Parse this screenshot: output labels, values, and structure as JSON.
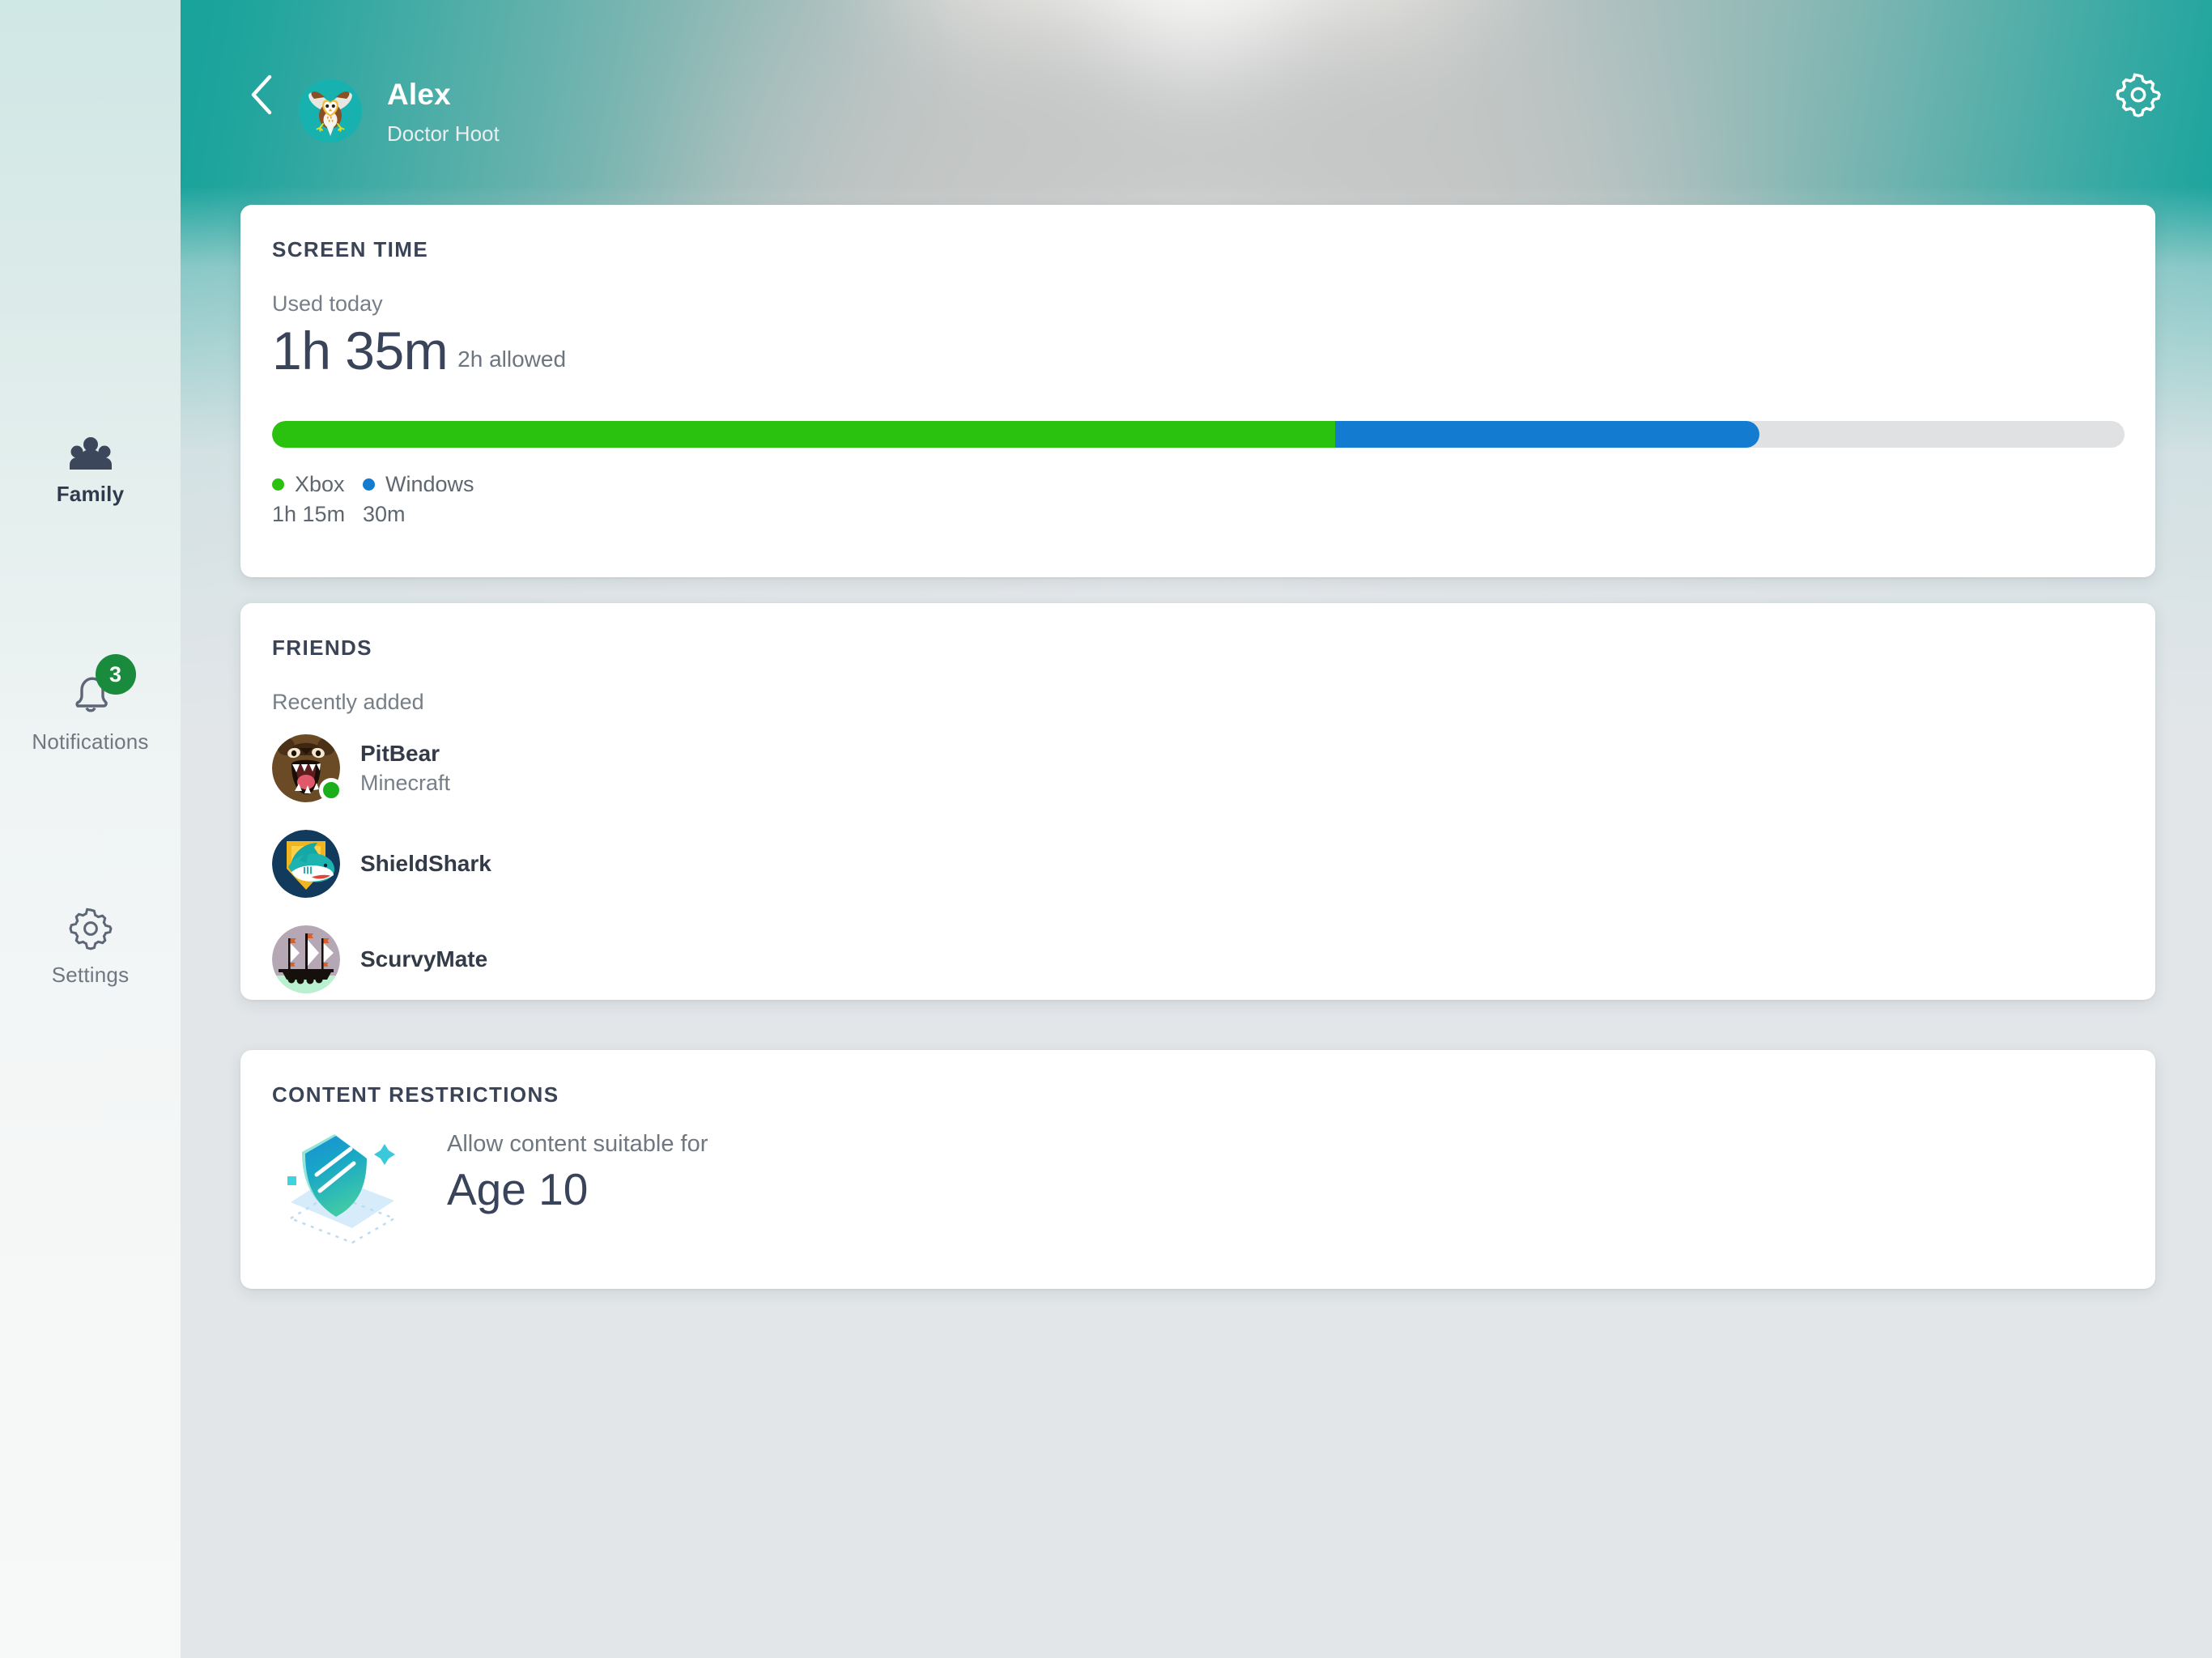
{
  "sidebar": {
    "items": [
      {
        "label": "Family",
        "icon": "family-icon",
        "active": true,
        "badge": null
      },
      {
        "label": "Notifications",
        "icon": "bell-icon",
        "active": false,
        "badge": "3"
      },
      {
        "label": "Settings",
        "icon": "gear-icon",
        "active": false,
        "badge": null
      }
    ]
  },
  "header": {
    "back_icon": "chevron-left-icon",
    "avatar_icon": "owl-avatar",
    "name": "Alex",
    "gamertag": "Doctor Hoot",
    "settings_icon": "gear-icon"
  },
  "screen_time": {
    "title": "SCREEN TIME",
    "used_label": "Used today",
    "used_value": "1h 35m",
    "allowed": "2h allowed",
    "legend": [
      {
        "name": "Xbox",
        "value": "1h 15m",
        "color": "#2ac20f"
      },
      {
        "name": "Windows",
        "value": "30m",
        "color": "#147cd0"
      }
    ],
    "bar": {
      "track_color": "#e0e1e2",
      "segments": [
        {
          "name": "Xbox",
          "color": "#2ac20f",
          "percent": 57.4
        },
        {
          "name": "Windows",
          "color": "#147cd0",
          "percent": 22.9
        }
      ]
    }
  },
  "friends": {
    "title": "FRIENDS",
    "subtitle": "Recently added",
    "items": [
      {
        "name": "PitBear",
        "status": "Minecraft",
        "online": true,
        "avatar": "bear-avatar"
      },
      {
        "name": "ShieldShark",
        "status": "",
        "online": false,
        "avatar": "shark-shield-avatar"
      },
      {
        "name": "ScurvyMate",
        "status": "",
        "online": false,
        "avatar": "pirate-ship-avatar"
      }
    ]
  },
  "content_restrictions": {
    "title": "CONTENT RESTRICTIONS",
    "icon": "shield-icon",
    "label": "Allow content suitable for",
    "value": "Age 10"
  }
}
